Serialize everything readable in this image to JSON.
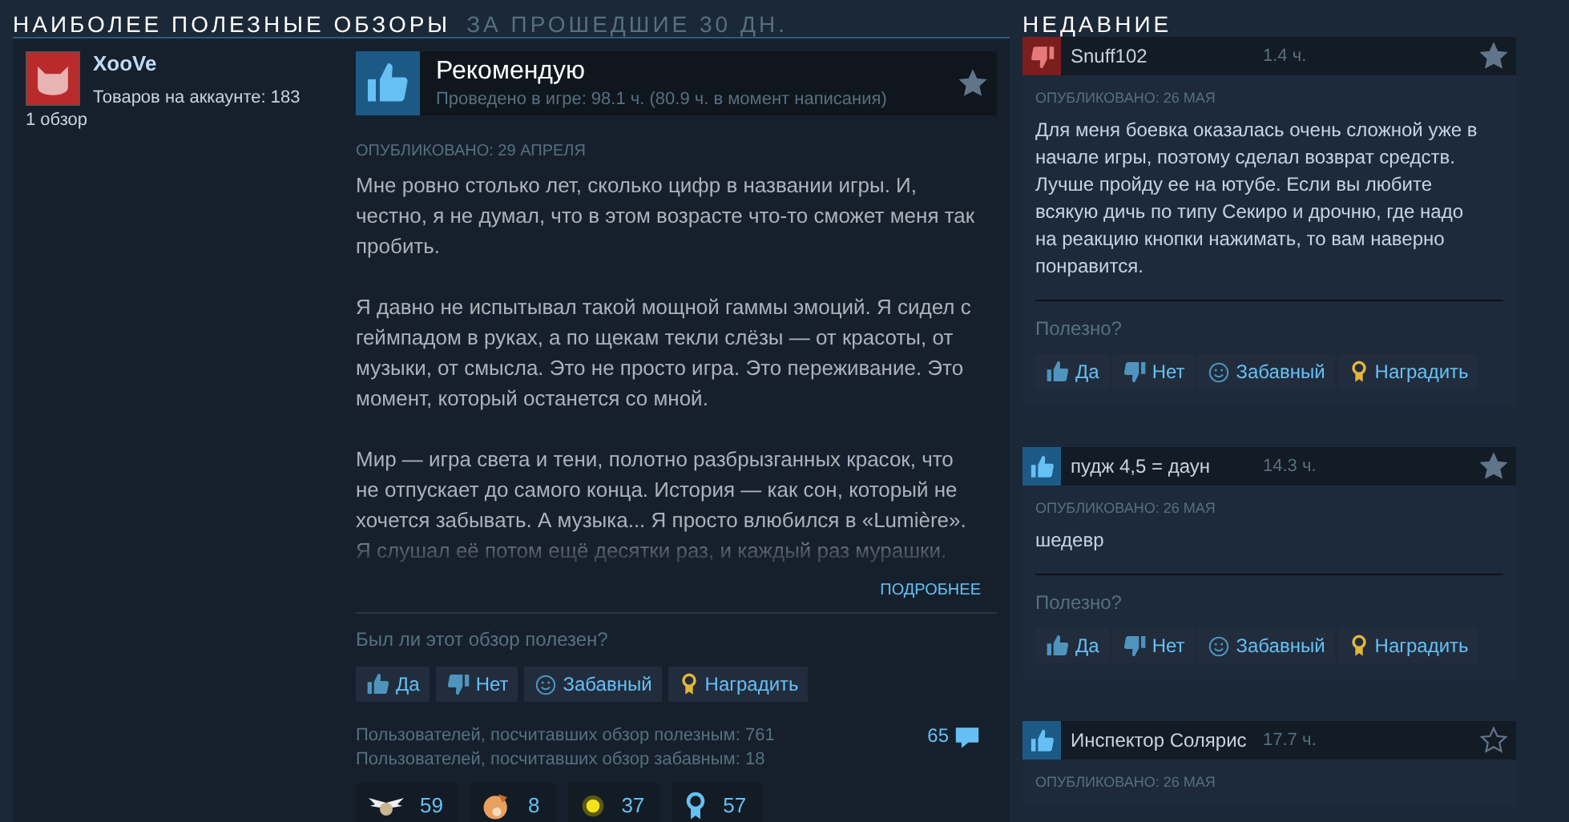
{
  "heading": {
    "title": "НАИБОЛЕЕ ПОЛЕЗНЫЕ ОБЗОРЫ",
    "subtitle": "ЗА ПРОШЕДШИЕ 30 ДН."
  },
  "featured": {
    "author": {
      "name": "XooVe",
      "products": "Товаров на аккаунте: 183",
      "reviews": "1 обзор"
    },
    "recommended": true,
    "verdict": "Рекомендую",
    "hours": "Проведено в игре: 98.1 ч. (80.9 ч. в момент написания)",
    "starred": true,
    "date": "ОПУБЛИКОВАНО: 29 АПРЕЛЯ",
    "paragraphs": [
      "Мне ровно столько лет, сколько цифр в названии игры. И, честно, я не думал, что в этом возрасте что-то сможет меня так пробить.",
      "Я давно не испытывал такой мощной гаммы эмоций. Я сидел с геймпадом в руках, а по щекам текли слёзы — от красоты, от музыки, от смысла. Это не просто игра. Это переживание. Это момент, который останется со мной.",
      "Мир — игра света и тени, полотно разбрызганных красок, что не отпускает до самого конца. История — как сон, который не хочется забывать. А музыка... Я просто влюбился в «Lumière». Я слушал её потом ещё десятки раз, и каждый раз мурашки."
    ],
    "more": "ПОДРОБНЕЕ",
    "question": "Был ли этот обзор полезен?",
    "votes": [
      {
        "kind": "yes",
        "label": "Да"
      },
      {
        "kind": "no",
        "label": "Нет"
      },
      {
        "kind": "funny",
        "label": "Забавный"
      },
      {
        "kind": "award",
        "label": "Наградить"
      }
    ],
    "stats": [
      "Пользователей, посчитавших обзор полезным: 761",
      "Пользователей, посчитавших обзор забавным: 18"
    ],
    "comments": "65",
    "awards": [
      {
        "kind": "wings",
        "count": "59"
      },
      {
        "kind": "creature",
        "count": "8"
      },
      {
        "kind": "glow",
        "count": "37"
      },
      {
        "kind": "ribbon",
        "count": "57"
      }
    ]
  },
  "recent": {
    "title": "НЕДАВНИЕ",
    "reviews": [
      {
        "recommended": false,
        "author": "Snuff102",
        "hours": "1.4 ч.",
        "starred": true,
        "date": "ОПУБЛИКОВАНО: 26 МАЯ",
        "text": "Для меня боевка оказалась очень сложной уже в начале игры, поэтому сделал возврат средств. Лучше пройду ее на ютубе. Если вы любите всякую дичь по типу Секиро и дрочню, где надо на реакцию кнопки нажимать, то вам наверно понравится.",
        "question": "Полезно?",
        "votes": [
          {
            "kind": "yes",
            "label": "Да"
          },
          {
            "kind": "no",
            "label": "Нет"
          },
          {
            "kind": "funny",
            "label": "Забавный"
          },
          {
            "kind": "award",
            "label": "Наградить"
          }
        ]
      },
      {
        "recommended": true,
        "author": "пудж 4,5 = даун",
        "hours": "14.3 ч.",
        "starred": true,
        "date": "ОПУБЛИКОВАНО: 26 МАЯ",
        "text": "шедевр",
        "question": "Полезно?",
        "votes": [
          {
            "kind": "yes",
            "label": "Да"
          },
          {
            "kind": "no",
            "label": "Нет"
          },
          {
            "kind": "funny",
            "label": "Забавный"
          },
          {
            "kind": "award",
            "label": "Наградить"
          }
        ]
      },
      {
        "recommended": true,
        "author": "Инспектор Солярис",
        "hours": "17.7 ч.",
        "starred": false,
        "date": "ОПУБЛИКОВАНО: 26 МАЯ"
      }
    ]
  }
}
